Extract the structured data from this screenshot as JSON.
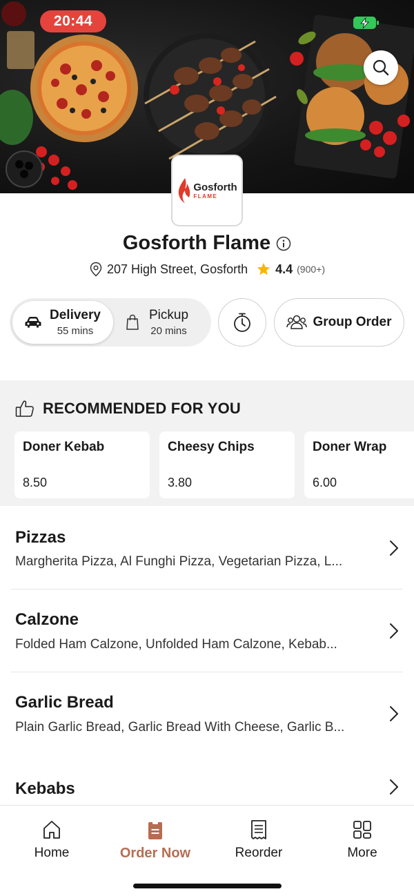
{
  "status_bar": {
    "time": "20:44"
  },
  "restaurant": {
    "logo_name": "Gosforth",
    "logo_sub": "FLAME",
    "name": "Gosforth Flame",
    "address": "207 High Street, Gosforth",
    "rating": "4.4",
    "rating_count": "(900+)"
  },
  "modes": {
    "delivery": {
      "label": "Delivery",
      "time": "55 mins"
    },
    "pickup": {
      "label": "Pickup",
      "time": "20 mins"
    },
    "group_order": "Group Order"
  },
  "recommended": {
    "title": "RECOMMENDED FOR YOU",
    "items": [
      {
        "name": "Doner Kebab",
        "price": "8.50"
      },
      {
        "name": "Cheesy Chips",
        "price": "3.80"
      },
      {
        "name": "Doner Wrap",
        "price": "6.00"
      }
    ]
  },
  "categories": [
    {
      "name": "Pizzas",
      "items": "Margherita Pizza, Al Funghi Pizza, Vegetarian Pizza, L..."
    },
    {
      "name": "Calzone",
      "items": "Folded Ham Calzone, Unfolded Ham Calzone, Kebab..."
    },
    {
      "name": "Garlic Bread",
      "items": "Plain Garlic Bread, Garlic Bread With Cheese, Garlic B..."
    },
    {
      "name": "Kebabs",
      "items": ""
    }
  ],
  "nav": {
    "home": "Home",
    "order_now": "Order Now",
    "reorder": "Reorder",
    "more": "More"
  },
  "colors": {
    "accent": "#b56d52",
    "time_pill": "#e5443d",
    "star": "#f5b700"
  }
}
